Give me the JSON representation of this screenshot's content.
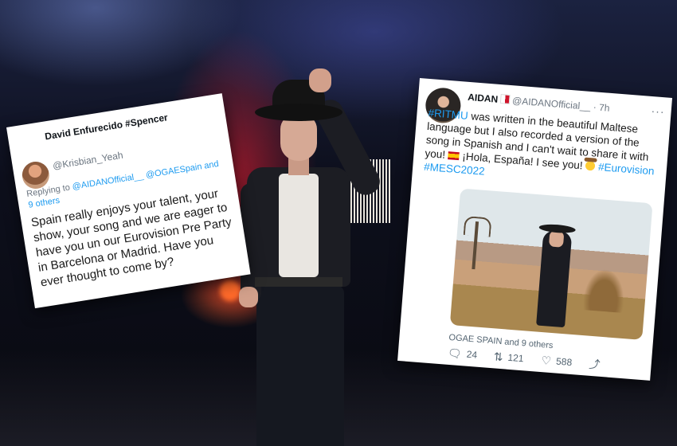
{
  "tweets": {
    "left": {
      "name": "David Enfurecido #Spencer",
      "handle": "@Krisbian_Yeah",
      "replying_prefix": "Replying to ",
      "replying_to": "@AIDANOfficial__ @OGAESpain and 9 others",
      "body": "Spain really enjoys your talent, your show, your song and we are eager to have you un our Eurovision Pre Party in Barcelona or Madrid. Have you ever thought to come by?"
    },
    "right": {
      "name": "AIDAN",
      "handle": "@AIDANOfficial__ · 7h",
      "more": "···",
      "hashtag_ritmu": "#RITMU",
      "body_1": " was written in the beautiful Maltese language but I also recorded a version of the song in Spanish and I can't wait to share it with you! ",
      "body_2": " ¡Hola, España! I see you! ",
      "hashtag_eurovision": "#Eurovision",
      "hashtag_mesc": "#MESC2022",
      "others": "OGAE SPAIN and 9 others",
      "reply_count": "24",
      "retweet_count": "121",
      "like_count": "588"
    }
  },
  "icons": {
    "reply": "reply-icon",
    "retweet": "retweet-icon",
    "like": "heart-icon",
    "share": "share-icon",
    "flag_malta": "malta-flag-icon",
    "flag_spain": "spain-flag-icon",
    "cowboy": "cowboy-emoji-icon"
  },
  "colors": {
    "link": "#1d9bf0",
    "text": "#0f1419",
    "muted": "#536471"
  }
}
